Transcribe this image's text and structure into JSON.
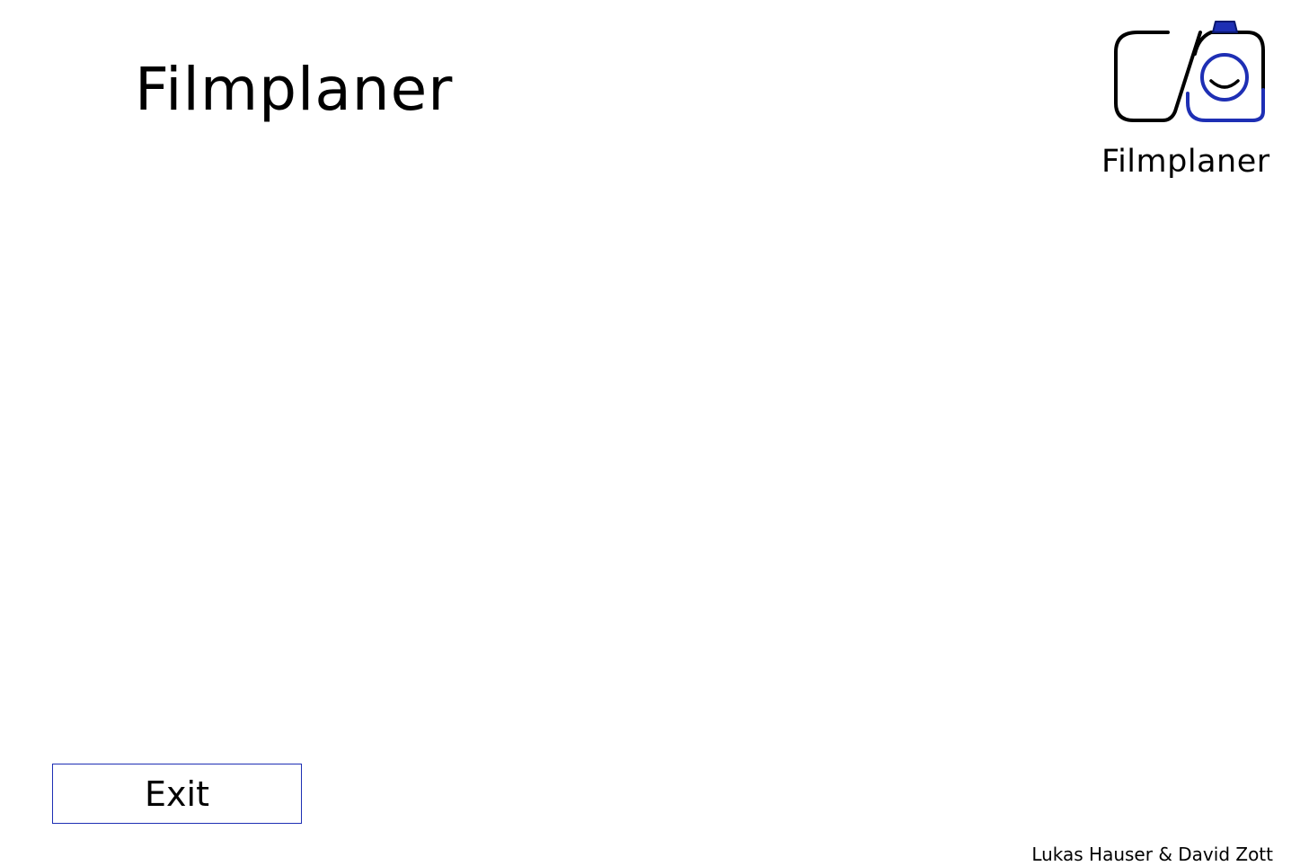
{
  "header": {
    "title": "Filmplaner"
  },
  "logo": {
    "wordmark": "Filmplaner",
    "icon": "camera-icon",
    "colors": {
      "outline": "#000000",
      "accent": "#1e2fb4"
    }
  },
  "footer": {
    "exit_label": "Exit",
    "credits": "Lukas Hauser & David Zott"
  },
  "colors": {
    "button_border": "#1e2fb4",
    "background": "#ffffff",
    "text": "#000000"
  }
}
